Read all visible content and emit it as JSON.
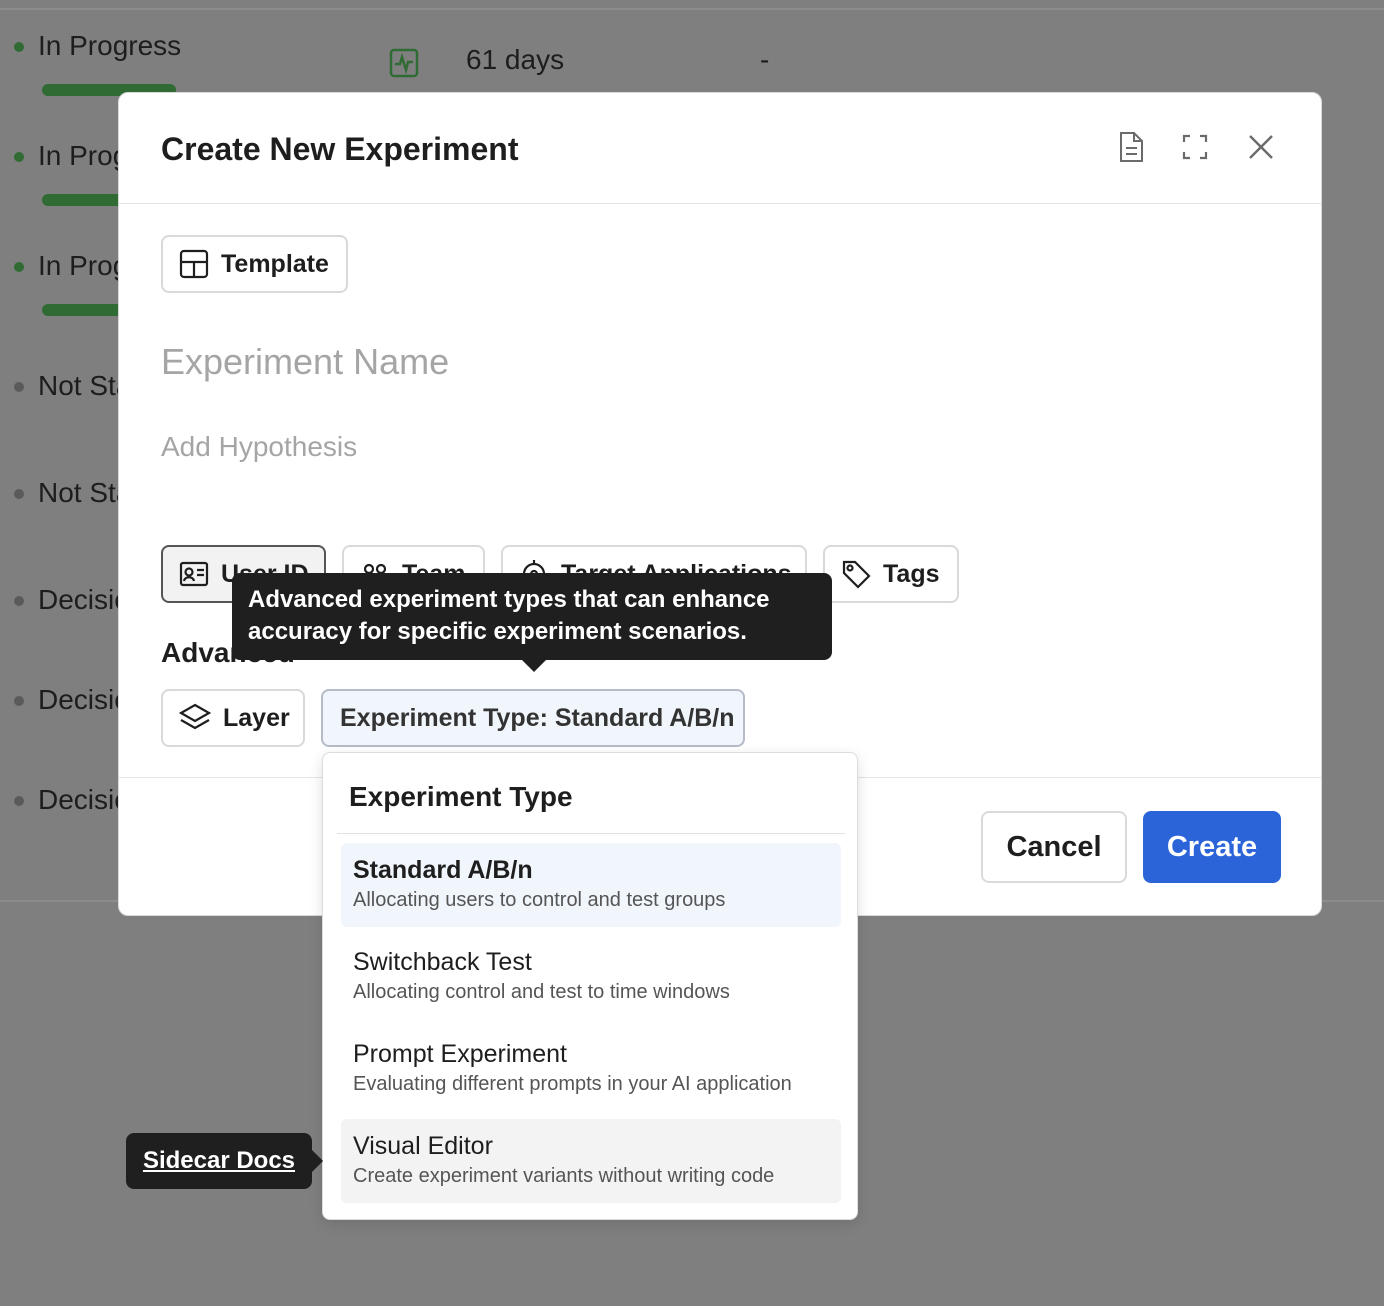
{
  "background": {
    "rows": [
      {
        "status": "In Progress",
        "status_color": "#2f6b33",
        "has_bar": true
      },
      {
        "status": "In Progress",
        "status_color": "#2f6b33",
        "has_bar": true
      },
      {
        "status": "In Progress",
        "status_color": "#2f6b33",
        "has_bar": true
      },
      {
        "status": "Not Started",
        "status_color": "#5a5a5a",
        "has_bar": false
      },
      {
        "status": "Not Started",
        "status_color": "#5a5a5a",
        "has_bar": false
      },
      {
        "status": "Decision Made",
        "status_color": "#5a5a5a",
        "has_bar": false
      },
      {
        "status": "Decision Made",
        "status_color": "#5a5a5a",
        "has_bar": false
      },
      {
        "status": "Decision Made",
        "status_color": "#5a5a5a",
        "has_bar": false
      }
    ],
    "first_row": {
      "duration": "61 days",
      "extra": "-",
      "icon": "activity-chart-icon"
    }
  },
  "modal": {
    "title": "Create New Experiment",
    "header_icons": [
      "document-icon",
      "expand-icon",
      "close-icon"
    ],
    "template_button": "Template",
    "name_placeholder": "Experiment Name",
    "hypothesis_placeholder": "Add Hypothesis",
    "chips": {
      "user_id": "User ID",
      "team": "Team",
      "target_applications": "Target Applications",
      "tags": "Tags"
    },
    "advanced_label": "Advanced",
    "layer_button": "Layer",
    "experiment_type_button": "Experiment Type: Standard A/B/n",
    "cancel_button": "Cancel",
    "create_button": "Create",
    "accent_color": "#2b63d9"
  },
  "tooltip": {
    "text": "Advanced experiment types that can enhance accuracy for specific experiment scenarios."
  },
  "dropdown": {
    "title": "Experiment Type",
    "items": [
      {
        "title": "Standard A/B/n",
        "description": "Allocating users to control and test groups",
        "state": "selected"
      },
      {
        "title": "Switchback Test",
        "description": "Allocating control and test to time windows",
        "state": "normal"
      },
      {
        "title": "Prompt Experiment",
        "description": "Evaluating different prompts in your AI application",
        "state": "normal"
      },
      {
        "title": "Visual Editor",
        "description": "Create experiment variants without writing code",
        "state": "hovered"
      }
    ]
  },
  "sidecar": {
    "label": "Sidecar Docs"
  }
}
